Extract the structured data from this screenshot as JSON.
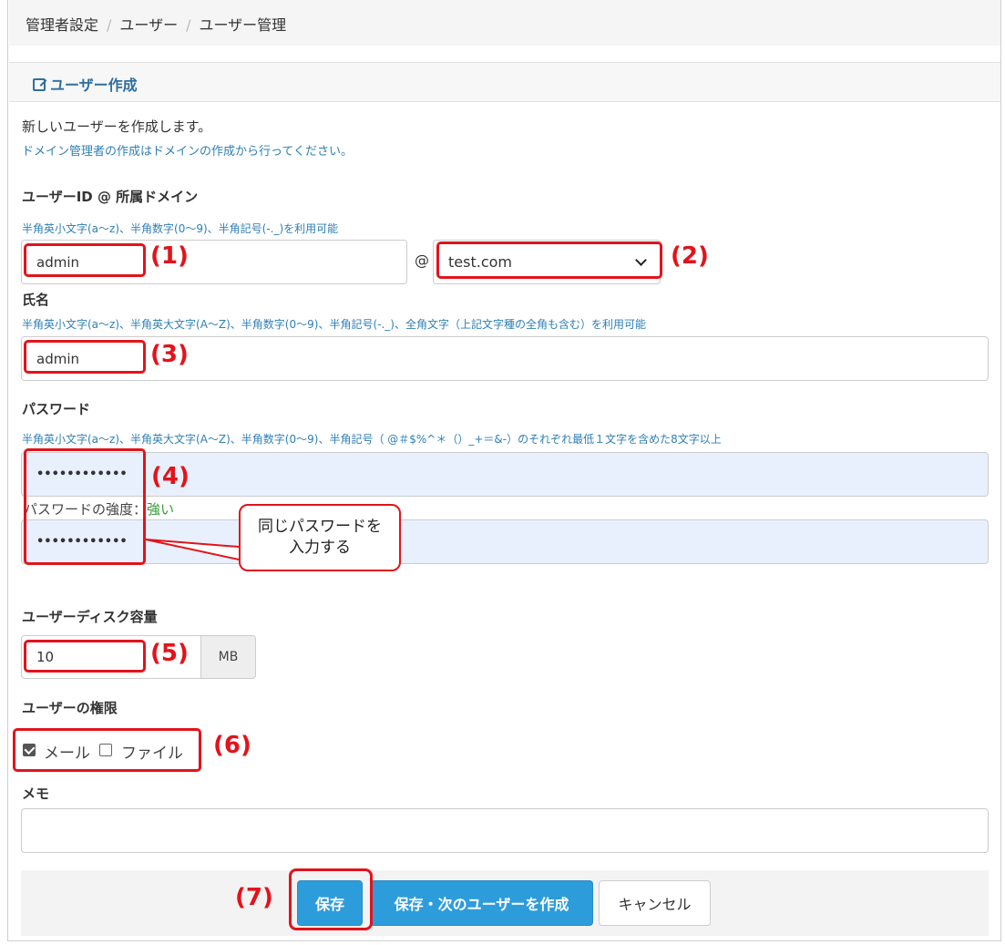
{
  "breadcrumb": [
    "管理者設定",
    "ユーザー",
    "ユーザー管理"
  ],
  "panel": {
    "title": "ユーザー作成",
    "icon": "edit-icon"
  },
  "intro": {
    "text": "新しいユーザーを作成します。",
    "note": "ドメイン管理者の作成はドメインの作成から行ってください。"
  },
  "user_id": {
    "label": "ユーザーID @ 所属ドメイン",
    "hint": "半角英小文字(a〜z)、半角数字(0〜9)、半角記号(-._)を利用可能",
    "value": "admin",
    "at": "@",
    "domain": "test.com"
  },
  "name": {
    "label": "氏名",
    "hint": "半角英小文字(a〜z)、半角英大文字(A〜Z)、半角数字(0〜9)、半角記号(-._)、全角文字（上記文字種の全角も含む）を利用可能",
    "value": "admin"
  },
  "password": {
    "label": "パスワード",
    "hint": "半角英小文字(a〜z)、半角英大文字(A〜Z)、半角数字(0〜9)、半角記号（ @＃$%^＊（）_+＝&-）のそれぞれ最低１文字を含めた8文字以上",
    "value": "••••••••••••",
    "confirm_value": "••••••••••••",
    "strength_label": "パスワードの強度：",
    "strength_value": "強い"
  },
  "disk": {
    "label": "ユーザーディスク容量",
    "value": "10",
    "unit": "MB"
  },
  "permissions": {
    "label": "ユーザーの権限",
    "items": [
      {
        "label": "メール",
        "checked": true
      },
      {
        "label": "ファイル",
        "checked": false
      }
    ]
  },
  "memo": {
    "label": "メモ",
    "value": ""
  },
  "buttons": {
    "save": "保存",
    "save_next": "保存・次のユーザーを作成",
    "cancel": "キャンセル"
  },
  "annotations": {
    "markers": [
      "(1)",
      "(2)",
      "(3)",
      "(4)",
      "(5)",
      "(6)",
      "(7)"
    ],
    "callout": [
      "同じパスワードを",
      "入力する"
    ],
    "color": "#e3131b"
  },
  "colors": {
    "primary": "#2d9cdb",
    "hint": "#2f7fb5",
    "strength": "#3a9b3a",
    "autofill": "#e8f0fe"
  }
}
